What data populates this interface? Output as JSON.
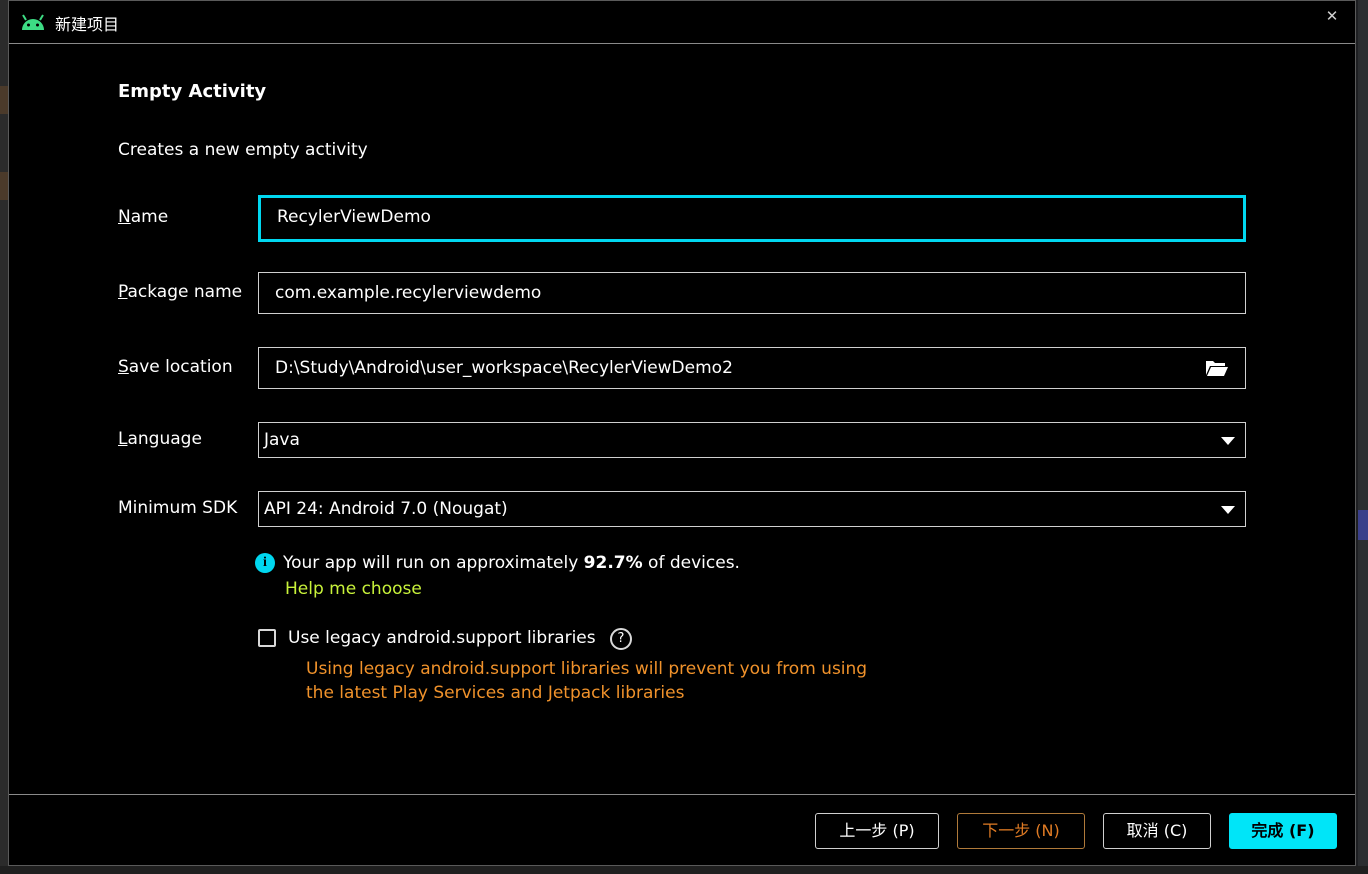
{
  "window": {
    "title": "新建项目",
    "icon": "android-robot-icon",
    "close_icon": "close-icon"
  },
  "template": {
    "heading": "Empty Activity",
    "description": "Creates a new empty activity"
  },
  "form": {
    "name": {
      "label_mnemonic": "N",
      "label_rest": "ame",
      "value": "RecylerViewDemo"
    },
    "package": {
      "label_mnemonic": "P",
      "label_rest": "ackage name",
      "value": "com.example.recylerviewdemo"
    },
    "save_location": {
      "label_mnemonic": "S",
      "label_rest": "ave location",
      "value": "D:\\Study\\Android\\user_workspace\\RecylerViewDemo2",
      "icon": "folder-open-icon"
    },
    "language": {
      "label_mnemonic": "L",
      "label_rest": "anguage",
      "value": "Java"
    },
    "min_sdk": {
      "label": "Minimum SDK",
      "value": "API 24: Android 7.0 (Nougat)"
    }
  },
  "info": {
    "prefix": "Your app will run on approximately ",
    "percent": "92.7%",
    "suffix": " of devices.",
    "help_link": "Help me choose"
  },
  "legacy": {
    "label": "Use legacy android.support libraries",
    "checked": false,
    "warning_line1": "Using legacy android.support libraries will prevent you from using",
    "warning_line2": "the latest Play Services and Jetpack libraries"
  },
  "buttons": {
    "previous": "上一步 (P)",
    "next": "下一步 (N)",
    "cancel": "取消 (C)",
    "finish": "完成 (F)"
  },
  "colors": {
    "accent": "#00e5f8",
    "link": "#c8f23a",
    "warning": "#f0922b",
    "android_green": "#3ddc84"
  }
}
